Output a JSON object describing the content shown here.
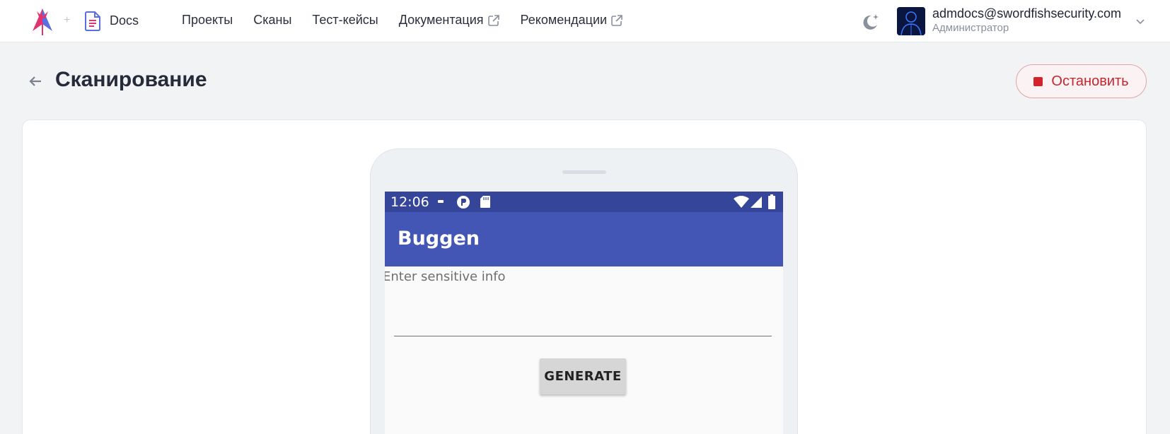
{
  "header": {
    "docs_label": "Docs",
    "nav": [
      {
        "label": "Проекты",
        "external": false
      },
      {
        "label": "Сканы",
        "external": false
      },
      {
        "label": "Тест-кейсы",
        "external": false
      },
      {
        "label": "Документация",
        "external": true
      },
      {
        "label": "Рекомендации",
        "external": true
      }
    ],
    "user": {
      "email": "admdocs@swordfishsecurity.com",
      "role": "Администратор"
    },
    "icons": [
      "logo",
      "docs-icon",
      "external-link-icon",
      "moon-icon",
      "chevron-down-icon"
    ]
  },
  "page": {
    "title": "Сканирование",
    "stop_label": "Остановить",
    "accent_color": "#c4262e"
  },
  "device": {
    "status_time": "12:06",
    "app_title": "Buggen",
    "input_hint": "Enter sensitive info",
    "generate_label": "GENERATE",
    "appbar_color": "#4456b5",
    "statusbar_color": "#35469a"
  }
}
